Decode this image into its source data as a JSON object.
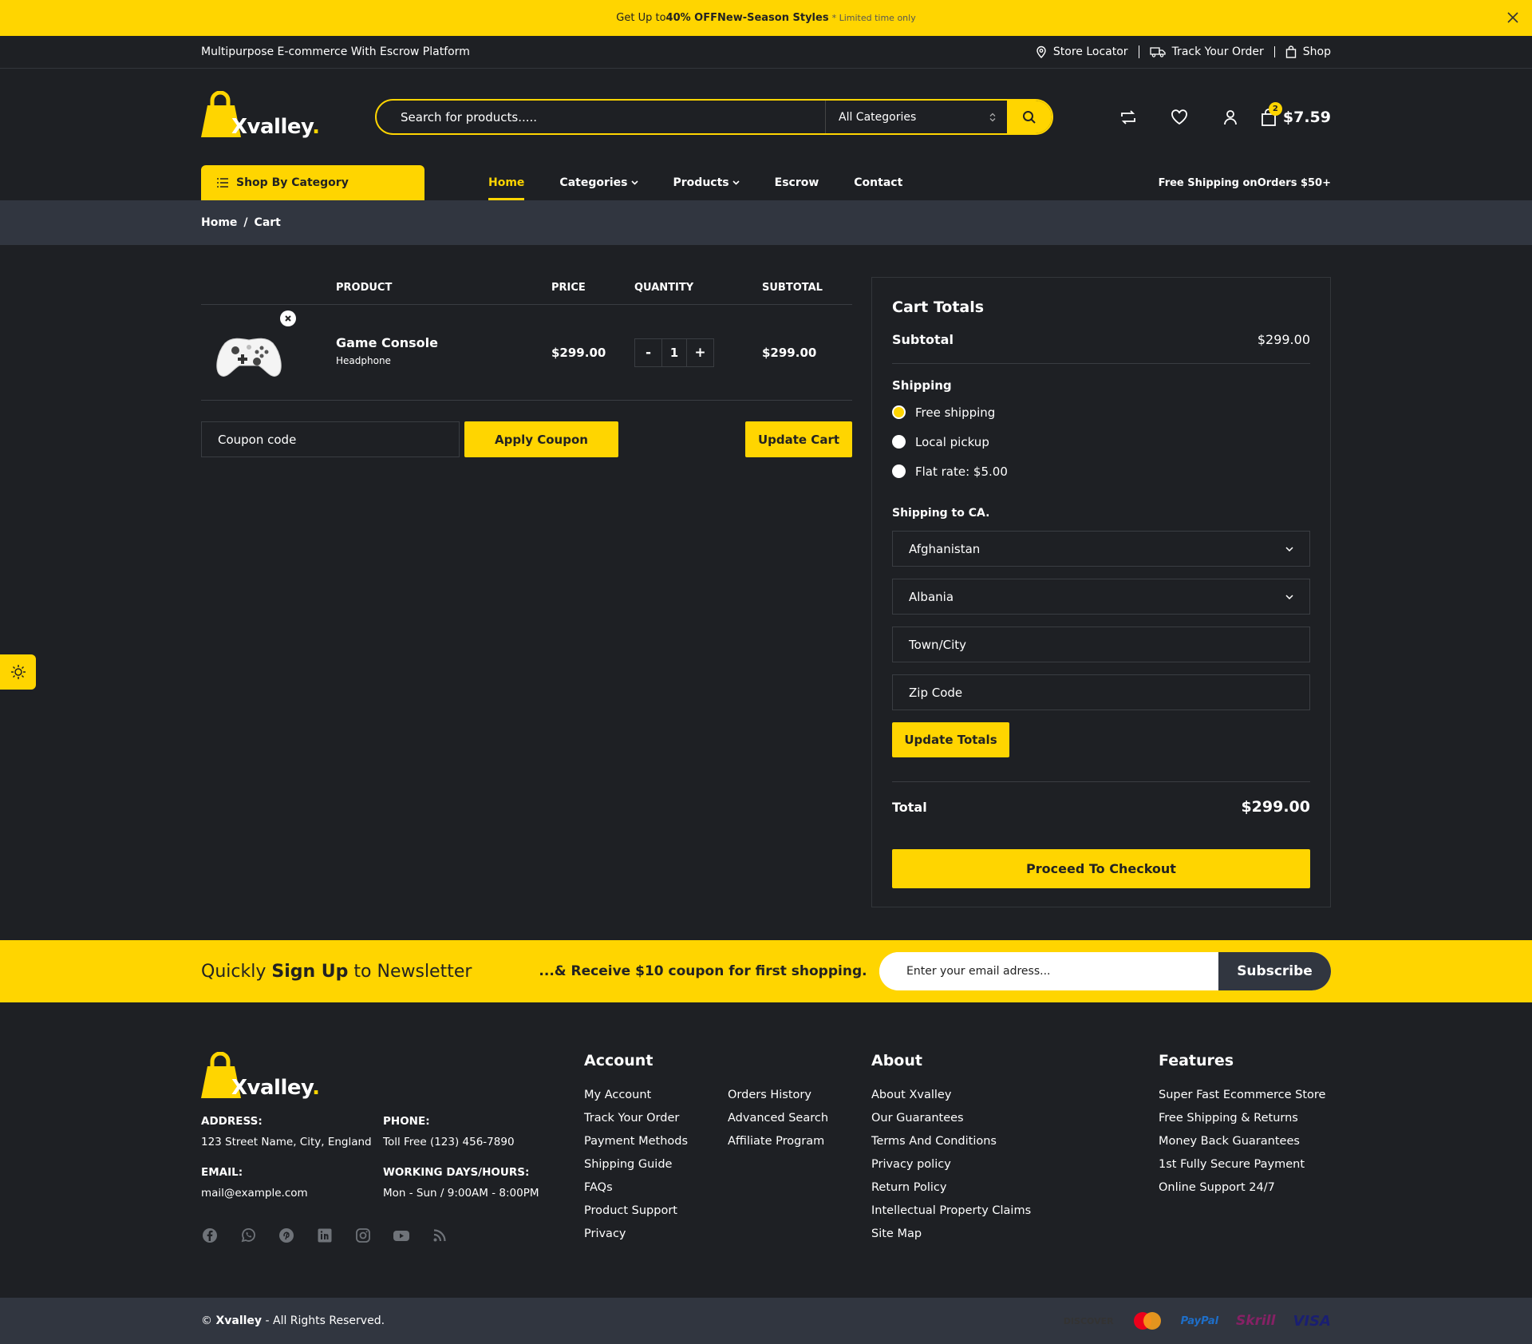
{
  "promo": {
    "lead": "Get Up to ",
    "discount": "40% OFF",
    "styles": " New-Season Styles",
    "note": "* Limited time only"
  },
  "topbar": {
    "tagline": "Multipurpose E-commerce With Escrow Platform",
    "links": [
      {
        "label": "Store Locator",
        "icon": "map-pin-icon"
      },
      {
        "label": "Track Your Order",
        "icon": "truck-icon"
      },
      {
        "label": "Shop",
        "icon": "shopping-bag-icon"
      }
    ]
  },
  "brand": {
    "name": "Xvalley",
    "dot": ".",
    "accent": "#ffd500"
  },
  "search": {
    "placeholder": "Search for products.....",
    "category": "All Categories"
  },
  "cart_summary": {
    "count": "2",
    "amount": "$7.59"
  },
  "nav": {
    "shop_by_category": "Shop By Category",
    "items": [
      {
        "label": "Home",
        "active": true
      },
      {
        "label": "Categories",
        "dropdown": true
      },
      {
        "label": "Products",
        "dropdown": true
      },
      {
        "label": "Escrow"
      },
      {
        "label": "Contact"
      }
    ],
    "free_shipping_lead": "Free Shipping on ",
    "free_shipping_bold": "Orders $50+"
  },
  "breadcrumb": {
    "home": "Home",
    "sep": "/",
    "current": "Cart"
  },
  "cart": {
    "headers": {
      "product": "PRODUCT",
      "price": "PRICE",
      "quantity": "QUANTITY",
      "subtotal": "SUBTOTAL"
    },
    "item": {
      "name": "Game Console",
      "variant": "Headphone",
      "price": "$299.00",
      "qty": "1",
      "subtotal": "$299.00"
    },
    "coupon_placeholder": "Coupon code",
    "apply_coupon": "Apply Coupon",
    "update_cart": "Update Cart"
  },
  "totals": {
    "title": "Cart Totals",
    "subtotal_label": "Subtotal",
    "subtotal_value": "$299.00",
    "shipping_label": "Shipping",
    "options": [
      "Free shipping",
      "Local pickup",
      "Flat rate: $5.00"
    ],
    "selected_option": "Free shipping",
    "shipping_to": "Shipping to CA.",
    "country": "Afghanistan",
    "state": "Albania",
    "city_placeholder": "Town/City",
    "zip_placeholder": "Zip Code",
    "update_totals": "Update Totals",
    "total_label": "Total",
    "total_value": "$299.00",
    "checkout": "Proceed To Checkout"
  },
  "newsletter": {
    "t1": "Quickly ",
    "t2": "Sign Up",
    "t3": " to Newsletter",
    "offer": "...& Receive $10 coupon for first shopping.",
    "placeholder": "Enter your email adress...",
    "button": "Subscribe"
  },
  "footer": {
    "address_label": "ADDRESS:",
    "address": "123 Street Name, City, England",
    "phone_label": "PHONE:",
    "phone": "Toll Free (123) 456-7890",
    "email_label": "EMAIL:",
    "email": "mail@example.com",
    "hours_label": "WORKING DAYS/HOURS:",
    "hours": "Mon - Sun / 9:00AM - 8:00PM",
    "socials": [
      "facebook-icon",
      "whatsapp-icon",
      "pinterest-icon",
      "linkedin-icon",
      "instagram-icon",
      "youtube-icon",
      "rss-icon"
    ],
    "account_title": "Account",
    "account_col1": [
      "My Account",
      "Track Your Order",
      "Payment Methods",
      "Shipping Guide",
      "FAQs",
      "Product Support",
      "Privacy"
    ],
    "account_col2": [
      "Orders History",
      "Advanced Search",
      "Affiliate Program"
    ],
    "about_title": "About",
    "about": [
      "About Xvalley",
      "Our Guarantees",
      "Terms And Conditions",
      "Privacy policy",
      "Return Policy",
      "Intellectual Property Claims",
      "Site Map"
    ],
    "features_title": "Features",
    "features": [
      "Super Fast Ecommerce Store",
      "Free Shipping & Returns",
      "Money Back Guarantees",
      "1st Fully Secure Payment",
      "Online Support 24/7"
    ]
  },
  "copyright": {
    "symbol": "© ",
    "brand": "Xvalley",
    "text": " - All Rights Reserved."
  },
  "payments": [
    {
      "name": "DISCOVER",
      "color": "#333333"
    },
    {
      "name": "mastercard",
      "color": "#eb001b"
    },
    {
      "name": "PayPal",
      "color": "#1e6ec8"
    },
    {
      "name": "Skrill",
      "color": "#862165"
    },
    {
      "name": "VISA",
      "color": "#1a1f71"
    }
  ]
}
